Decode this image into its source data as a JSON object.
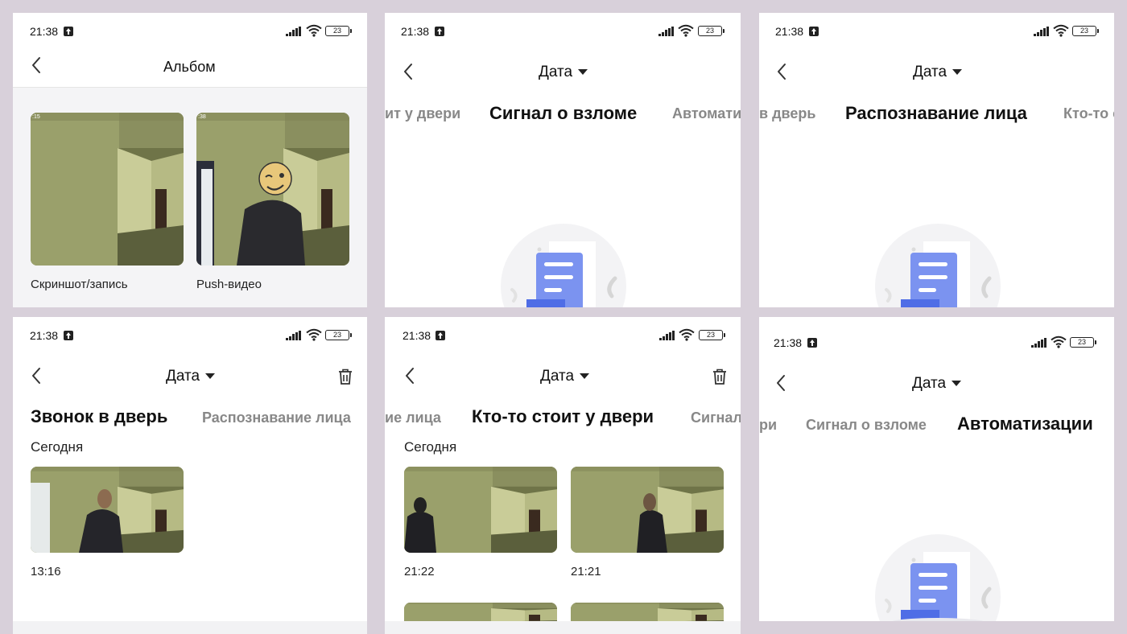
{
  "status": {
    "time": "21:38",
    "battery": "23"
  },
  "album": {
    "title": "Альбом",
    "items": [
      {
        "label": "Скриншот/запись",
        "stamp": ":15"
      },
      {
        "label": "Push-видео",
        "stamp": ":38"
      }
    ]
  },
  "filter": {
    "date_label": "Дата"
  },
  "tabs": {
    "break_in": {
      "left": "ит у двери",
      "active": "Сигнал о взломе",
      "right": "Автомати"
    },
    "face": {
      "left": "в дверь",
      "active": "Распознавание лица",
      "right": "Кто-то с"
    },
    "doorbell": {
      "active": "Звонок в дверь",
      "right": "Распознавание лица"
    },
    "someone": {
      "left": "ие лица",
      "active": "Кто-то стоит у двери",
      "right": "Сигнал"
    },
    "auto": {
      "left": "ри",
      "middle": "Сигнал о взломе",
      "active": "Автоматизации"
    }
  },
  "doorbell_events": {
    "section": "Сегодня",
    "items": [
      {
        "time": "13:16"
      }
    ]
  },
  "someone_events": {
    "section": "Сегодня",
    "items": [
      {
        "time": "21:22"
      },
      {
        "time": "21:21"
      }
    ]
  },
  "colors": {
    "background": "#d8d0da",
    "panel": "#ffffff",
    "tab_inactive": "#888888",
    "illustration_blue": "#7b93f0"
  }
}
